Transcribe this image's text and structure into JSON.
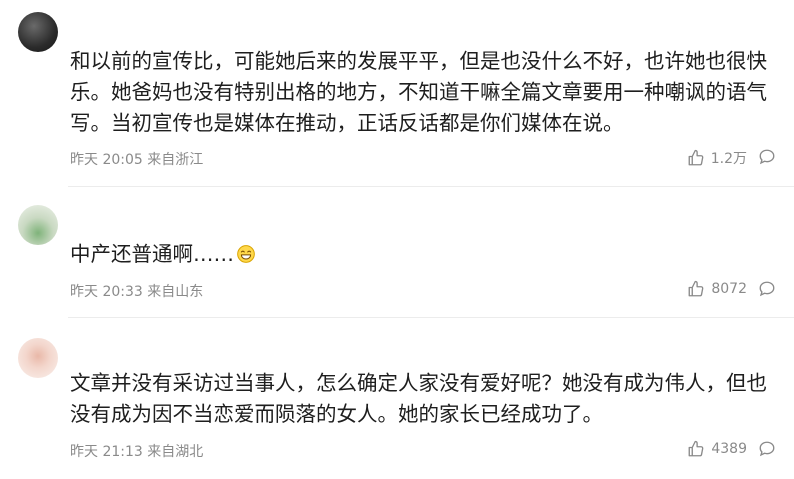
{
  "comments": [
    {
      "username": "",
      "text": "和以前的宣传比，可能她后来的发展平平，但是也没什么不好，也许她也很快乐。她爸妈也没有特别出格的地方，不知道干嘛全篇文章要用一种嘲讽的语气写。当初宣传也是媒体在推动，正话反话都是你们媒体在说。",
      "time": "昨天 20:05",
      "location": "来自浙江",
      "likes": "1.2万"
    },
    {
      "username": "",
      "text": "中产还普通啊……",
      "time": "昨天 20:33",
      "location": "来自山东",
      "likes": "8072"
    },
    {
      "username": "",
      "text": "文章并没有采访过当事人，怎么确定人家没有爱好呢？她没有成为伟人，但也没有成为因不当恋爱而陨落的女人。她的家长已经成功了。",
      "time": "昨天 21:13",
      "location": "来自湖北",
      "likes": "4389"
    }
  ],
  "icons": {
    "like": "thumbs-up-icon",
    "reply": "comment-bubble-icon",
    "emoji": "grinning-emoji-icon"
  },
  "colors": {
    "text": "#1e1e1e",
    "meta": "#8a8a8a",
    "divider": "#ececec"
  }
}
